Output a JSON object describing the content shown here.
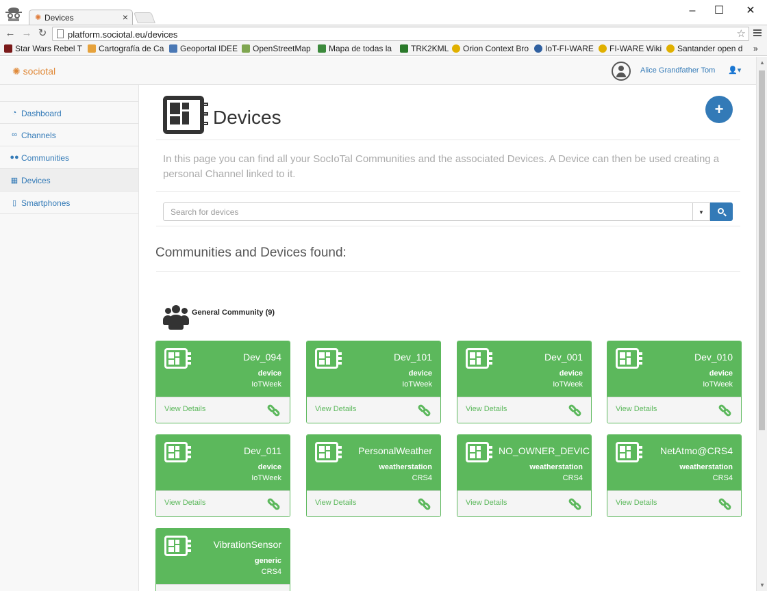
{
  "browser": {
    "tab_title": "Devices",
    "tab_close": "×",
    "url": "platform.sociotal.eu/devices",
    "window_controls": {
      "minimize": "–",
      "maximize": "☐",
      "close": "✕"
    },
    "bookmarks": [
      {
        "label": "Star Wars Rebel T",
        "icon_color": "#7a1a1a"
      },
      {
        "label": "Cartografía de Ca",
        "icon_color": "#e6a23c"
      },
      {
        "label": "Geoportal IDEE",
        "icon_color": "#4a78b5"
      },
      {
        "label": "OpenStreetMap",
        "icon_color": "#7fa650"
      },
      {
        "label": "Mapa de todas la",
        "icon_color": "#3c8a3c"
      },
      {
        "label": "TRK2KML",
        "icon_color": "#2b7a2b"
      },
      {
        "label": "Orion Context Bro",
        "icon_color": "#e0b000"
      },
      {
        "label": "IoT-FI-WARE",
        "icon_color": "#3060a0"
      },
      {
        "label": "FI-WARE Wiki",
        "icon_color": "#e0b000"
      },
      {
        "label": "Santander open d",
        "icon_color": "#e0b000"
      }
    ],
    "bookmarks_more": "»"
  },
  "app": {
    "logo": "sociotal",
    "user_name": "Alice Grandfather Tom",
    "user_menu_caret": "▾"
  },
  "sidebar": {
    "items": [
      {
        "label": "Dashboard",
        "icon": "dashboard-icon"
      },
      {
        "label": "Channels",
        "icon": "link-icon"
      },
      {
        "label": "Communities",
        "icon": "users-icon"
      },
      {
        "label": "Devices",
        "icon": "device-icon",
        "active": true
      },
      {
        "label": "Smartphones",
        "icon": "mobile-icon"
      }
    ]
  },
  "main": {
    "title": "Devices",
    "add_label": "+",
    "intro": "In this page you can find all your SocIoTal Communities and the associated Devices. A Device can then be used creating a personal Channel linked to it.",
    "search_placeholder": "Search for devices",
    "found_heading": "Communities and Devices found:",
    "community": {
      "label": "General Community (9)"
    },
    "view_details": "View Details",
    "devices": [
      {
        "name": "Dev_094",
        "type": "device",
        "owner": "IoTWeek"
      },
      {
        "name": "Dev_101",
        "type": "device",
        "owner": "IoTWeek"
      },
      {
        "name": "Dev_001",
        "type": "device",
        "owner": "IoTWeek"
      },
      {
        "name": "Dev_010",
        "type": "device",
        "owner": "IoTWeek"
      },
      {
        "name": "Dev_011",
        "type": "device",
        "owner": "IoTWeek"
      },
      {
        "name": "PersonalWeather",
        "type": "weatherstation",
        "owner": "CRS4"
      },
      {
        "name": "NO_OWNER_DEVIC",
        "type": "weatherstation",
        "owner": "CRS4"
      },
      {
        "name": "NetAtmo@CRS4",
        "type": "weatherstation",
        "owner": "CRS4"
      },
      {
        "name": "VibrationSensor",
        "type": "generic",
        "owner": "CRS4"
      }
    ]
  },
  "colors": {
    "accent": "#337ab7",
    "card_green": "#5cb85c",
    "logo_orange": "#e08a3a"
  }
}
